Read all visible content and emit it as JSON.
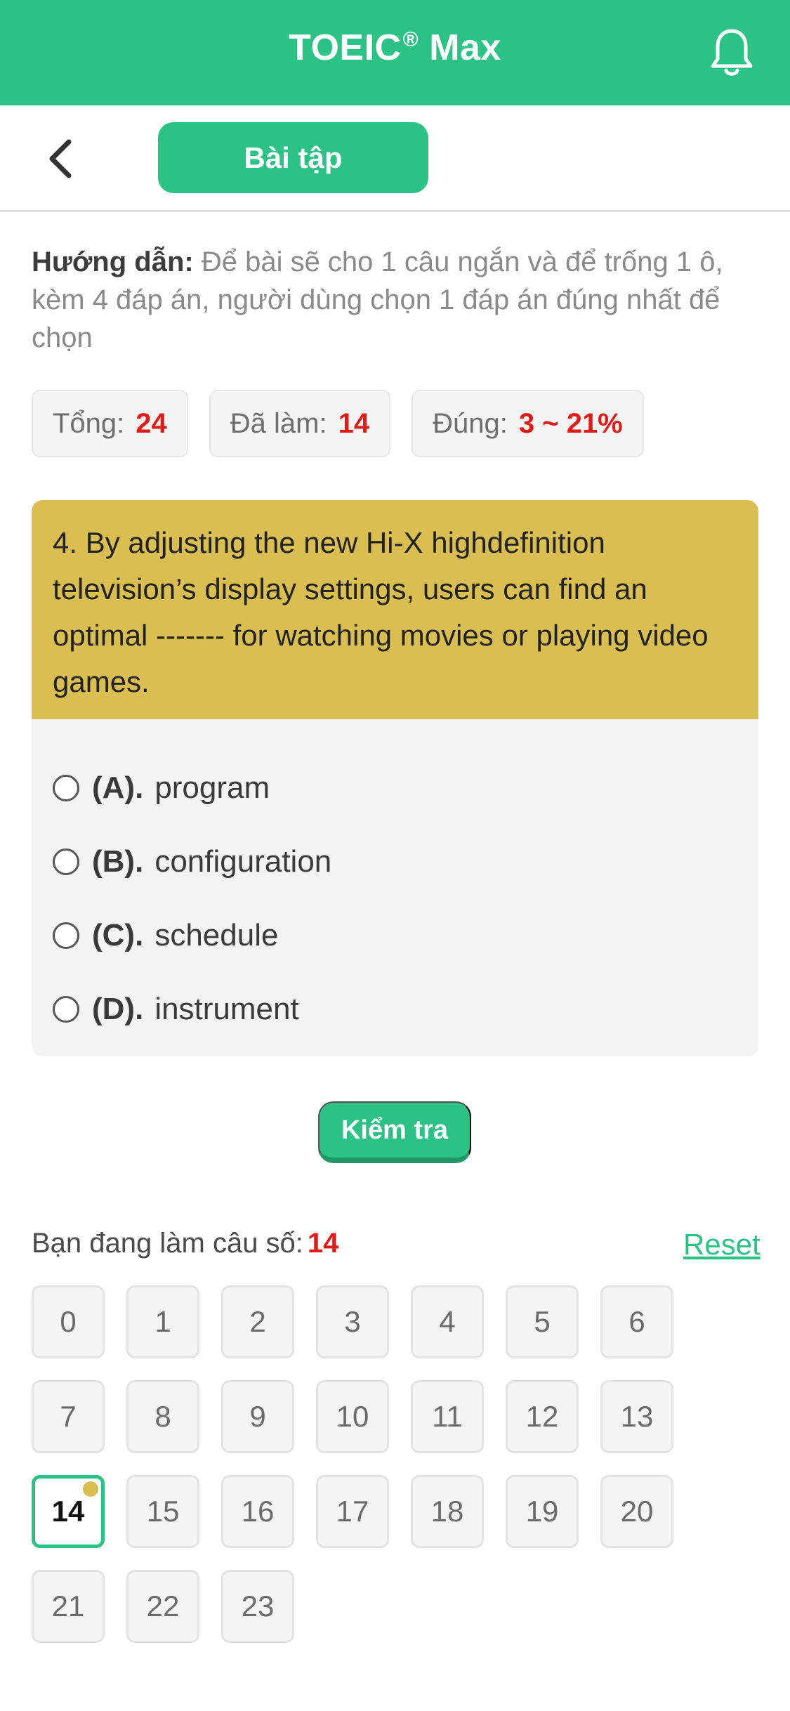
{
  "app": {
    "title": "TOEIC",
    "title_mark": "®",
    "title_suffix": "Max",
    "accent": "#2dc285",
    "highlight": "#dbbe52"
  },
  "toolbar": {
    "tab_label": "Bài tập"
  },
  "guide": {
    "label": "Hướng dẫn:",
    "text": "Để bài sẽ cho 1 câu ngắn và để trống 1 ô, kèm 4 đáp án, người dùng chọn 1 đáp án đúng nhất để chọn"
  },
  "stats": [
    {
      "label": "Tổng:",
      "value": "24"
    },
    {
      "label": "Đã làm:",
      "value": "14"
    },
    {
      "label": "Đúng:",
      "value": "3 ~ 21%"
    }
  ],
  "question": {
    "text": "4. By adjusting the new Hi-X highdefinition television’s display settings, users can find an optimal ------- for watching movies or playing video games.",
    "options": [
      {
        "letter": "(A).",
        "text": "program"
      },
      {
        "letter": "(B).",
        "text": "configuration"
      },
      {
        "letter": "(C).",
        "text": "schedule"
      },
      {
        "letter": "(D).",
        "text": "instrument"
      }
    ]
  },
  "check_button": "Kiểm tra",
  "progress": {
    "label": "Bạn đang làm câu số:",
    "current": "14",
    "reset_label": "Reset"
  },
  "questions_grid": [
    "0",
    "1",
    "2",
    "3",
    "4",
    "5",
    "6",
    "7",
    "8",
    "9",
    "10",
    "11",
    "12",
    "13",
    "14",
    "15",
    "16",
    "17",
    "18",
    "19",
    "20",
    "21",
    "22",
    "23"
  ]
}
